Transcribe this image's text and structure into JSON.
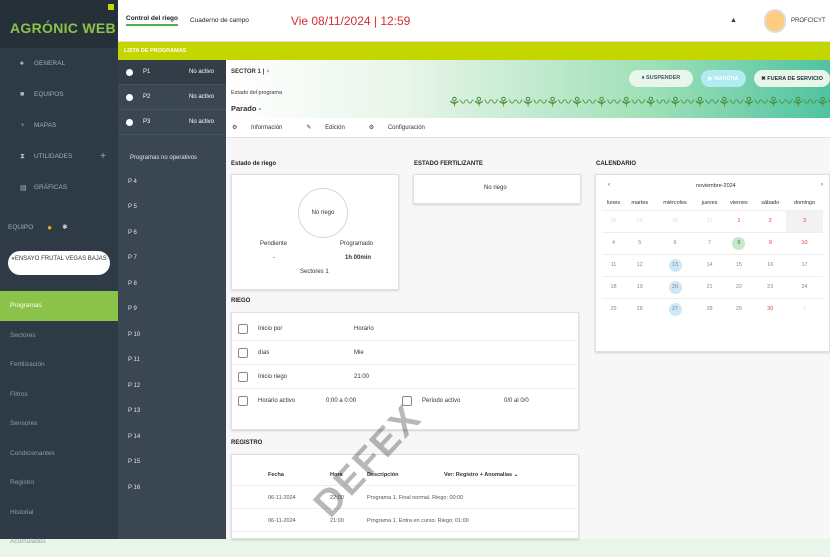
{
  "app": {
    "title": "AGRÓNIC WEB"
  },
  "nav": [
    {
      "label": "GENERAL",
      "icon": "home-icon"
    },
    {
      "label": "EQUIPOS",
      "icon": "grid-icon"
    },
    {
      "label": "MAPAS",
      "icon": "map-pin-icon"
    },
    {
      "label": "UTILIDADES",
      "icon": "hourglass-icon"
    },
    {
      "label": "GRÁFICAS",
      "icon": "chart-icon"
    }
  ],
  "equipo": {
    "label": "EQUIPO",
    "device": "ENSAYO FRUTAL VEGAS BAJAS"
  },
  "menu": [
    "Programas",
    "Sectores",
    "Fertilización",
    "Filtros",
    "Sensores",
    "Condicionantes",
    "Registro",
    "Historial",
    "Acumulados"
  ],
  "top": {
    "tab1": "Control del riego",
    "tab2": "Cuaderno de campo",
    "date": "Vie 08/11/2024 | 12:59",
    "user": "PROFCICYT"
  },
  "strip": "LISTA DE PROGRAMAS",
  "programs_active": [
    {
      "id": "P1",
      "status": "No activo"
    },
    {
      "id": "P2",
      "status": "No activo"
    },
    {
      "id": "P3",
      "status": "No activo"
    }
  ],
  "programs_inactive_header": "Programas no operativos",
  "programs_inactive": [
    "P 4",
    "P 5",
    "P 6",
    "P 7",
    "P 8",
    "P 9",
    "P 10",
    "P 11",
    "P 12",
    "P 13",
    "P 14",
    "P 15",
    "P 16"
  ],
  "header": {
    "sector": "SECTOR 1 | ♀",
    "estado_label": "Estado del programa",
    "estado": "Parado -",
    "btn_suspend": "⏸ SUSPENDER",
    "btn_start": "▶ MARCHA",
    "btn_out": "✖ FUERA DE SERVICIO"
  },
  "subtabs": [
    "Información",
    "Edición",
    "Configuración"
  ],
  "riego": {
    "title": "Estado de riego",
    "status": "No riego",
    "pendiente_label": "Pendiente",
    "pendiente": "-",
    "programado_label": "Programado",
    "programado": "1h 00min",
    "sectores": "Sectores 1"
  },
  "fert": {
    "title": "ESTADO FERTILIZANTE",
    "status": "No riego"
  },
  "cal": {
    "title": "CALENDARIO",
    "month": "noviembre-2024",
    "days": [
      "lunes",
      "martes",
      "miércoles",
      "jueves",
      "viernes",
      "sábado",
      "domingo"
    ],
    "weeks": [
      [
        "28",
        "29",
        "30",
        "31",
        "1",
        "2",
        "3"
      ],
      [
        "4",
        "5",
        "6",
        "7",
        "8",
        "9",
        "10"
      ],
      [
        "11",
        "12",
        "13",
        "14",
        "15",
        "16",
        "17"
      ],
      [
        "18",
        "19",
        "20",
        "21",
        "22",
        "23",
        "24"
      ],
      [
        "25",
        "26",
        "27",
        "28",
        "29",
        "30",
        "1"
      ]
    ]
  },
  "riego2": {
    "title": "RIEGO",
    "inicio_label": "Inicio por",
    "inicio": "Horario",
    "dias_label": "días",
    "dias": "Mie",
    "inicio_riego_label": "Inicio riego",
    "inicio_riego": "21:00",
    "horario_label": "Horario activo",
    "horario": "0:00 a 0:00",
    "periodo_label": "Período activo",
    "periodo": "0/0 al 0/0"
  },
  "registro": {
    "title": "REGISTRO",
    "cols": [
      "Fecha",
      "Hora",
      "Descripción",
      "Ver: Registro + Anomalías ⌄"
    ],
    "rows": [
      {
        "fecha": "06-11-2024",
        "hora": "22:00",
        "desc": "Programa 1. Final normal. Riego: 00:00"
      },
      {
        "fecha": "06-11-2024",
        "hora": "21:00",
        "desc": "Programa 1. Entra en curso. Riego: 01:00"
      }
    ]
  },
  "watermark": "DEFEX"
}
